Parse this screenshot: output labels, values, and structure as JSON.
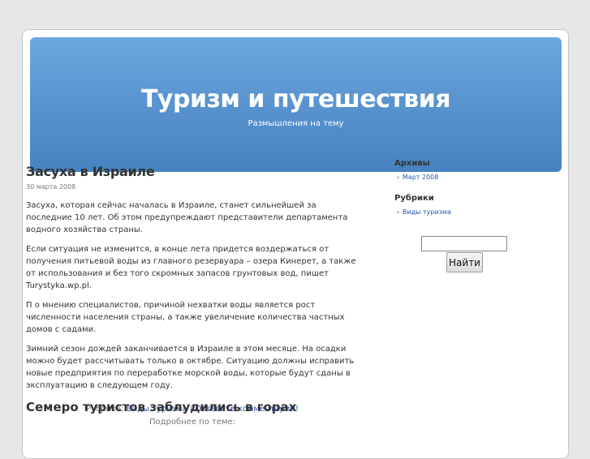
{
  "header": {
    "title": "Туризм и путешествия",
    "description": "Размышления на тему"
  },
  "post": {
    "title": "Засуха в Израиле",
    "date": "30 марта 2008",
    "paragraphs": [
      "Засуха, которая сейчас началась в Израиле, станет сильнейшей за последние 10 лет. Об этом предупреждают представители департамента водного хозяйства страны.",
      "Если ситуация не изменится, в конце лета придется воздержаться от получения питьевой воды из главного резервуара – озера Кинерет, а также от использования и без того скромных запасов грунтовых вод, пишет Turystyka.wp.pl.",
      "П о мнению специалистов, причиной нехватки воды является рост численности населения страны, а также увеличение количества частных домов с садами.",
      "Зимний сезон дождей заканчивается в Израиле в этом месяце. На осадки можно будет рассчитывать только в октябре. Ситуацию должны исправить новые предприятия по переработке морской воды, которые будут сданы в эксплуатацию в следующем году."
    ],
    "category_label": "Рубрика:",
    "category_link": "Виды туризма",
    "separator": "|",
    "comment_link": "Оставьте комментарий!",
    "related_label": "Подробнее по теме:"
  },
  "next_post": {
    "title": "Семеро туристов заблудились в горах"
  },
  "sidebar": {
    "archives": {
      "title": "Архивы",
      "items": [
        "Март 2008"
      ]
    },
    "categories": {
      "title": "Рубрики",
      "items": [
        "Виды туризма"
      ]
    },
    "bullet": "»",
    "search": {
      "value": "",
      "button_label": "Найти"
    }
  }
}
